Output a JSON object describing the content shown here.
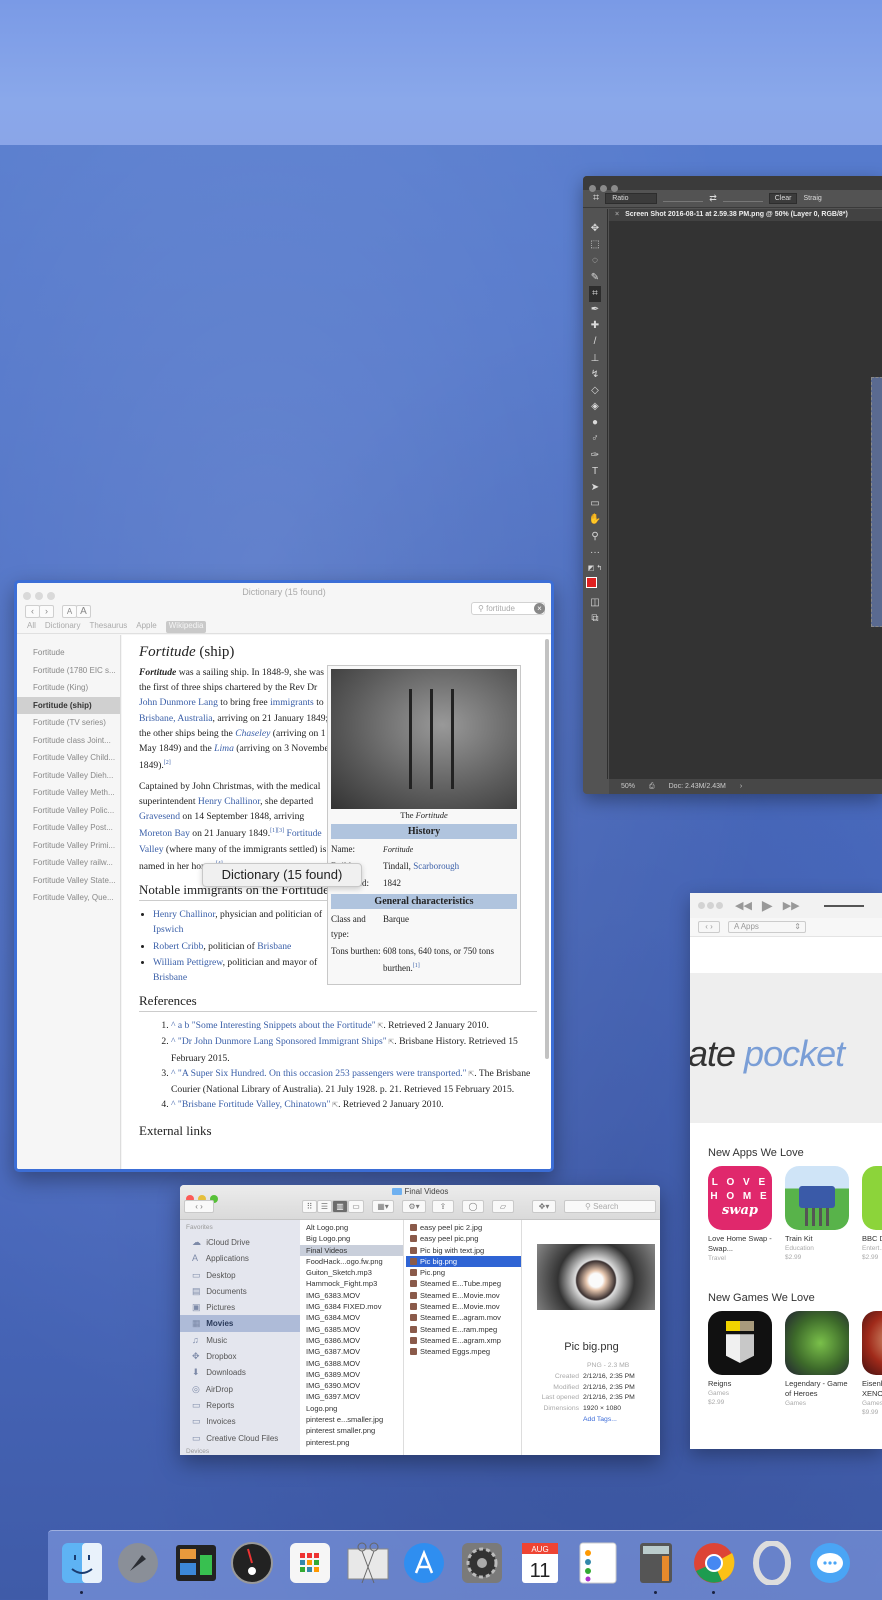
{
  "photoshop": {
    "crop_option": "Ratio",
    "clear_label": "Clear",
    "straighten_label": "Straig",
    "document_tab": "Screen Shot 2016-08-11 at 2.59.38 PM.png @ 50% (Layer 0, RGB/8*)",
    "zoom_level": "50%",
    "doc_size": "Doc: 2.43M/2.43M",
    "tools": [
      "move",
      "marquee",
      "lasso",
      "quick-select",
      "crop",
      "eyedropper",
      "healing",
      "brush",
      "stamp",
      "history-brush",
      "eraser",
      "paint-bucket",
      "blur",
      "dodge",
      "pen",
      "type",
      "path-select",
      "rectangle",
      "hand",
      "zoom",
      "more",
      "swap-colors",
      "colors",
      "quick-mask",
      "screen-mode"
    ],
    "foreground_color": "#e02020",
    "background_color": "#3b3bf0"
  },
  "dictionary": {
    "window_title": "Dictionary (15 found)",
    "search_value": "fortitude",
    "font_smaller": "A",
    "font_larger": "A",
    "tabs": [
      "All",
      "Dictionary",
      "Thesaurus",
      "Apple",
      "Wikipedia"
    ],
    "active_tab": "Wikipedia",
    "entries": [
      "Fortitude",
      "Fortitude (1780 EIC s...",
      "Fortitude (King)",
      "Fortitude (ship)",
      "Fortitude (TV series)",
      "Fortitude class Joint...",
      "Fortitude Valley Child...",
      "Fortitude Valley Dieh...",
      "Fortitude Valley Meth...",
      "Fortitude Valley Polic...",
      "Fortitude Valley Post...",
      "Fortitude Valley Primi...",
      "Fortitude Valley railw...",
      "Fortitude Valley State...",
      "Fortitude Valley, Que..."
    ],
    "selected_entry": "Fortitude (ship)",
    "article": {
      "title_italic": "Fortitude",
      "title_rest": " (ship)",
      "p1": {
        "bold": "Fortitude",
        "t1": " was a sailing ship. In 1848-9, she was the first of three ships chartered by the Rev Dr ",
        "l1": "John Dunmore Lang",
        "t2": " to bring free ",
        "l2": "immigrants",
        "t3": " to ",
        "l3": "Brisbane, Australia",
        "t4": ", arriving on 21 January 1849; the other ships being the ",
        "l4": "Chaseley",
        "t5": " (arriving on 1 May 1849) and the ",
        "l5": "Lima",
        "t6": " (arriving on 3 November 1849).",
        "ref": "[2]"
      },
      "p2": {
        "t1": "Captained by John Christmas, with the medical superintendent ",
        "l1": "Henry Challinor",
        "t2": ", she departed ",
        "l2": "Gravesend",
        "t3": " on 14 September 1848, arriving ",
        "l3": "Moreton Bay",
        "t4": " on 21 January 1849.",
        "ref1": "[1][3]",
        "l4": "Fortitude Valley",
        "t5": " (where many of the immigrants settled) is named in her honor.",
        "ref2": "[4]"
      },
      "notable_heading": "Notable immigrants on the Fortitude",
      "notable": [
        {
          "link": "Henry Challinor",
          "text": ", physician and politician of ",
          "link2": "Ipswich"
        },
        {
          "link": "Robert Cribb",
          "text": ", politician of ",
          "link2": "Brisbane"
        },
        {
          "link": "William Pettigrew",
          "text": ", politician and mayor of ",
          "link2": "Brisbane"
        }
      ],
      "references_heading": "References",
      "references": [
        {
          "pre": "^ a b ",
          "link": "\"Some Interesting Snippets about the Fortitude\"",
          "post": ". Retrieved 2 January 2010."
        },
        {
          "pre": "^ ",
          "link": "\"Dr John Dunmore Lang Sponsored Immigrant Ships\"",
          "post": ". Brisbane History. Retrieved 15 February 2015."
        },
        {
          "pre": "^ ",
          "link": "\"A Super Six Hundred. On this occasion 253 passengers were transported.\"",
          "post": ". The Brisbane Courier (National Library of Australia). 21 July 1928. p. 21. Retrieved 15 February 2015."
        },
        {
          "pre": "^ ",
          "link": "\"Brisbane Fortitude Valley, Chinatown\"",
          "post": ". Retrieved 2 January 2010."
        }
      ],
      "external_heading": "External links"
    },
    "infobox": {
      "caption_pre": "The ",
      "caption_italic": "Fortitude",
      "history_heading": "History",
      "rows_history": [
        {
          "k": "Name:",
          "v": "Fortitude"
        },
        {
          "k": "Builder:",
          "v": "Tindall, ",
          "link": "Scarborough"
        },
        {
          "k": "Launched:",
          "v": "1842"
        }
      ],
      "general_heading": "General characteristics",
      "rows_general": [
        {
          "k": "Class and type:",
          "v": "Barque"
        },
        {
          "k": "Tons burthen:",
          "v": "608 tons, 640 tons, or 750 tons burthen.",
          "ref": "[1]"
        }
      ]
    },
    "tooltip": "Dictionary (15 found)"
  },
  "appstore": {
    "nav_select": "Apps",
    "hero_text_dark": "ate ",
    "hero_text_color": "pocket",
    "section_apps": "New Apps We Love",
    "apps": [
      {
        "name": "Love Home Swap - Swap...",
        "category": "Travel",
        "price": ""
      },
      {
        "name": "Train Kit",
        "category": "Education",
        "price": "$2.99"
      },
      {
        "name": "BBC Doctor...",
        "category": "Entert...",
        "price": "$2.99"
      }
    ],
    "section_games": "New Games We Love",
    "games": [
      {
        "name": "Reigns",
        "category": "Games",
        "price": "$2.99"
      },
      {
        "name": "Legendary - Game of Heroes",
        "category": "Games",
        "price": ""
      },
      {
        "name": "Eisenhorn: XENOS",
        "category": "Games",
        "price": "$9.99"
      }
    ]
  },
  "finder": {
    "title": "Final Videos",
    "search_placeholder": "Search",
    "sidebar_heading": "Favorites",
    "sidebar": [
      {
        "icon": "☁",
        "label": "iCloud Drive"
      },
      {
        "icon": "A",
        "label": "Applications"
      },
      {
        "icon": "▭",
        "label": "Desktop"
      },
      {
        "icon": "▤",
        "label": "Documents"
      },
      {
        "icon": "▣",
        "label": "Pictures"
      },
      {
        "icon": "▦",
        "label": "Movies"
      },
      {
        "icon": "♫",
        "label": "Music"
      },
      {
        "icon": "✥",
        "label": "Dropbox"
      },
      {
        "icon": "⬇",
        "label": "Downloads"
      },
      {
        "icon": "◎",
        "label": "AirDrop"
      },
      {
        "icon": "▭",
        "label": "Reports"
      },
      {
        "icon": "▭",
        "label": "Invoices"
      },
      {
        "icon": "▭",
        "label": "Creative Cloud Files"
      }
    ],
    "sidebar_devices": "Devices",
    "selected_sidebar": "Movies",
    "column1": [
      "Alt Logo.png",
      "Big Logo.png",
      "Final Videos",
      "FoodHack...ogo.fw.png",
      "Guiton_Sketch.mp3",
      "Hammock_Fight.mp3",
      "IMG_6383.MOV",
      "IMG_6384 FIXED.mov",
      "IMG_6384.MOV",
      "IMG_6385.MOV",
      "IMG_6386.MOV",
      "IMG_6387.MOV",
      "IMG_6388.MOV",
      "IMG_6389.MOV",
      "IMG_6390.MOV",
      "IMG_6397.MOV",
      "Logo.png",
      "pinterest e...smaller.jpg",
      "pinterest smaller.png",
      "pinterest.png"
    ],
    "column1_open": "Final Videos",
    "column2": [
      "easy peel pic 2.jpg",
      "easy peel pic.png",
      "Pic big with text.jpg",
      "Pic big.png",
      "Pic.png",
      "Steamed E...Tube.mpeg",
      "Steamed E...Movie.mov",
      "Steamed E...Movie.mov",
      "Steamed E...agram.mov",
      "Steamed E...ram.mpeg",
      "Steamed E...agram.xmp",
      "Steamed Eggs.mpeg"
    ],
    "selected_file": "Pic big.png",
    "preview": {
      "name": "Pic big.png",
      "kind": "PNG - 2.3 MB",
      "rows": [
        {
          "k": "Created",
          "v": "2/12/16, 2:35 PM"
        },
        {
          "k": "Modified",
          "v": "2/12/16, 2:35 PM"
        },
        {
          "k": "Last opened",
          "v": "2/12/16, 2:35 PM"
        },
        {
          "k": "Dimensions",
          "v": "1920 × 1080"
        }
      ],
      "add_tags": "Add Tags..."
    }
  },
  "dock": {
    "items": [
      {
        "name": "finder",
        "running": true
      },
      {
        "name": "launchpad",
        "running": false
      },
      {
        "name": "mission-control",
        "running": false
      },
      {
        "name": "dashboard",
        "running": false
      },
      {
        "name": "app-grid",
        "running": false
      },
      {
        "name": "screenshot-scissors",
        "running": false
      },
      {
        "name": "app-store",
        "running": false
      },
      {
        "name": "system-preferences",
        "running": false
      },
      {
        "name": "calendar",
        "running": false
      },
      {
        "name": "reminders",
        "running": false
      },
      {
        "name": "calculator",
        "running": true
      },
      {
        "name": "chrome",
        "running": true
      },
      {
        "name": "opera",
        "running": false
      },
      {
        "name": "messages",
        "running": false
      }
    ],
    "calendar_month": "AUG",
    "calendar_day": "11"
  }
}
